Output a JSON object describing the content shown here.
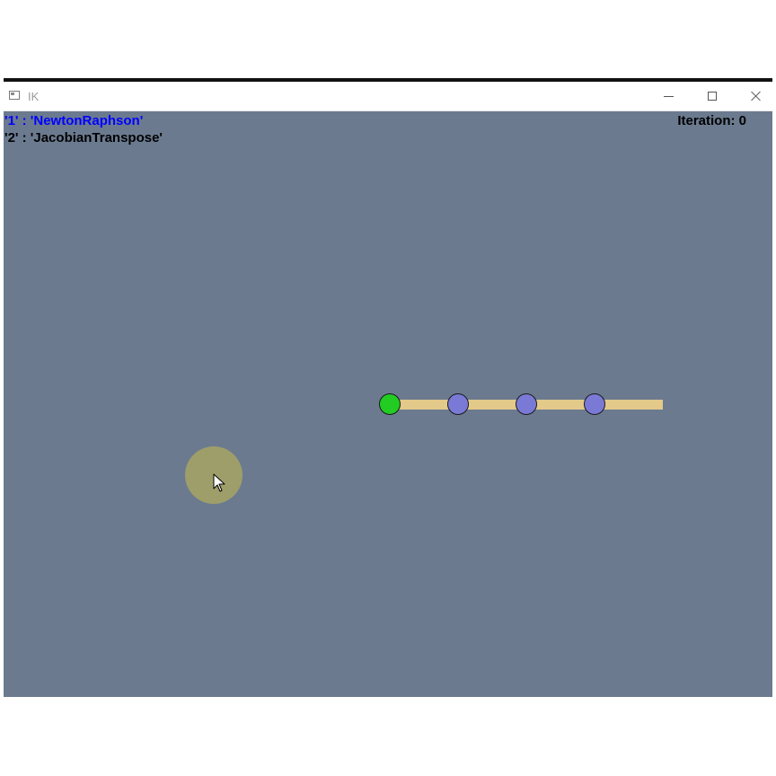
{
  "window": {
    "title": "IK",
    "minimize_icon": "minimize-icon",
    "maximize_icon": "maximize-icon",
    "close_icon": "close-icon"
  },
  "overlay": {
    "modes": [
      {
        "text": "'1' : 'NewtonRaphson'",
        "active": true
      },
      {
        "text": "'2' : 'JacobianTranspose'",
        "active": false
      }
    ],
    "iteration_text": "Iteration: 0"
  },
  "scene": {
    "joint_count": 4,
    "link_count": 4,
    "colors": {
      "background": "#6b7a8f",
      "active_mode_text": "#0000ff",
      "inactive_mode_text": "#000000",
      "link": "#e3c98a",
      "root_joint": "#22cc22",
      "joint": "#7a7ad6",
      "target": "#9e9e6b"
    },
    "target_icon": "mouse-cursor-icon"
  }
}
